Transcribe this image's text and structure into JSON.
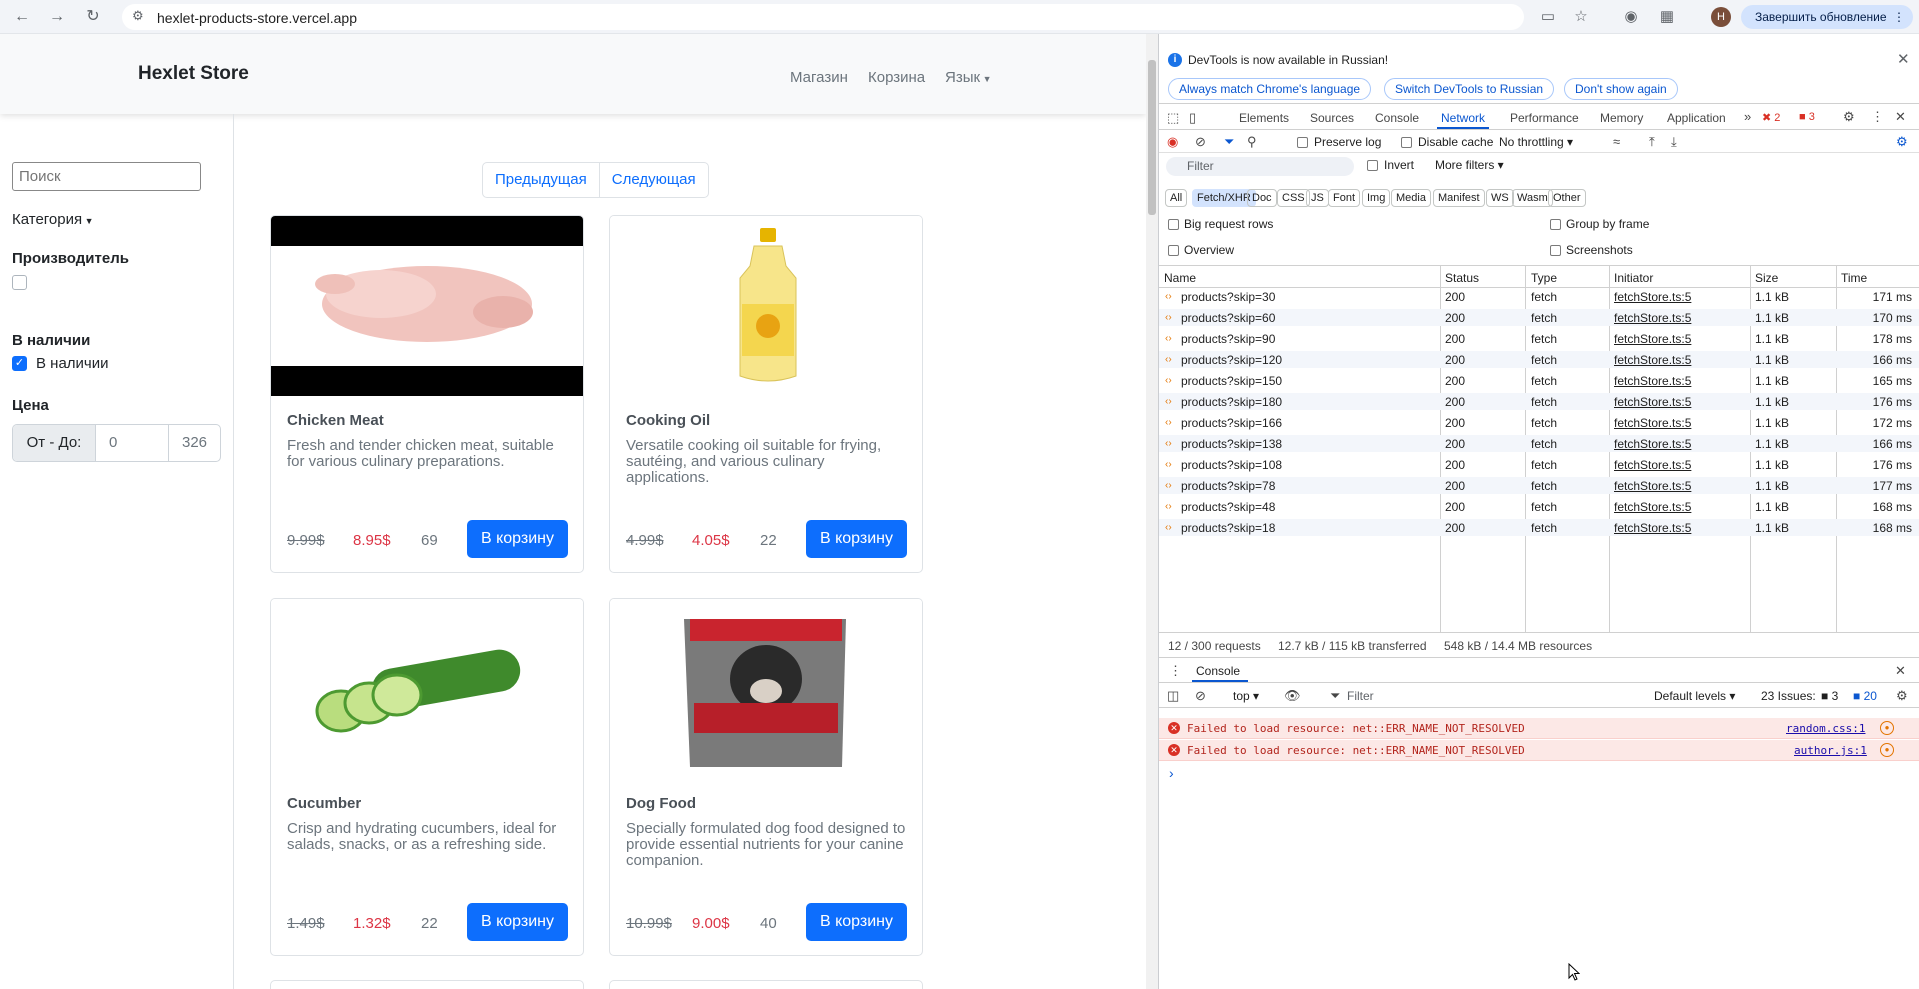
{
  "browser": {
    "url": "hexlet-products-store.vercel.app",
    "avatar_letter": "H",
    "update_label": "Завершить обновление"
  },
  "site": {
    "brand": "Hexlet Store",
    "menu": [
      "Магазин",
      "Корзина",
      "Язык"
    ],
    "search_placeholder": "Поиск",
    "category_label": "Категория",
    "manufacturer_label": "Производитель",
    "stock_heading": "В наличии",
    "stock_checkbox": "В наличии",
    "price_heading": "Цена",
    "price_range_label": "От - До:",
    "price_min": "0",
    "price_max": "326",
    "prev_label": "Предыдущая",
    "next_label": "Следующая",
    "buy_label": "В корзину",
    "products": [
      {
        "title": "Chicken Meat",
        "desc": "Fresh and tender chicken meat, suitable for various culinary preparations.",
        "old": "9.99$",
        "new": "8.95$",
        "qty": "69"
      },
      {
        "title": "Cooking Oil",
        "desc": "Versatile cooking oil suitable for frying, sautéing, and various culinary applications.",
        "old": "4.99$",
        "new": "4.05$",
        "qty": "22"
      },
      {
        "title": "Cucumber",
        "desc": "Crisp and hydrating cucumbers, ideal for salads, snacks, or as a refreshing side.",
        "old": "1.49$",
        "new": "1.32$",
        "qty": "22"
      },
      {
        "title": "Dog Food",
        "desc": "Specially formulated dog food designed to provide essential nutrients for your canine companion.",
        "old": "10.99$",
        "new": "9.00$",
        "qty": "40"
      }
    ]
  },
  "devtools": {
    "info_msg": "DevTools is now available in Russian!",
    "info_buttons": [
      "Always match Chrome's language",
      "Switch DevTools to Russian",
      "Don't show again"
    ],
    "tabs": [
      "Elements",
      "Sources",
      "Console",
      "Network",
      "Performance",
      "Memory",
      "Application"
    ],
    "active_tab": "Network",
    "error_count": "2",
    "warn_count": "3",
    "preserve_log": "Preserve log",
    "disable_cache": "Disable cache",
    "throttling": "No throttling",
    "filter_placeholder": "Filter",
    "invert": "Invert",
    "more_filters": "More filters",
    "type_filters": [
      "All",
      "Fetch/XHR",
      "Doc",
      "CSS",
      "JS",
      "Font",
      "Img",
      "Media",
      "Manifest",
      "WS",
      "Wasm",
      "Other"
    ],
    "selected_type": "Fetch/XHR",
    "options": [
      "Big request rows",
      "Group by frame",
      "Overview",
      "Screenshots"
    ],
    "columns": [
      "Name",
      "Status",
      "Type",
      "Initiator",
      "Size",
      "Time"
    ],
    "requests": [
      {
        "name": "products?skip=30",
        "status": "200",
        "type": "fetch",
        "initiator": "fetchStore.ts:5",
        "size": "1.1 kB",
        "time": "171 ms"
      },
      {
        "name": "products?skip=60",
        "status": "200",
        "type": "fetch",
        "initiator": "fetchStore.ts:5",
        "size": "1.1 kB",
        "time": "170 ms"
      },
      {
        "name": "products?skip=90",
        "status": "200",
        "type": "fetch",
        "initiator": "fetchStore.ts:5",
        "size": "1.1 kB",
        "time": "178 ms"
      },
      {
        "name": "products?skip=120",
        "status": "200",
        "type": "fetch",
        "initiator": "fetchStore.ts:5",
        "size": "1.1 kB",
        "time": "166 ms"
      },
      {
        "name": "products?skip=150",
        "status": "200",
        "type": "fetch",
        "initiator": "fetchStore.ts:5",
        "size": "1.1 kB",
        "time": "165 ms"
      },
      {
        "name": "products?skip=180",
        "status": "200",
        "type": "fetch",
        "initiator": "fetchStore.ts:5",
        "size": "1.1 kB",
        "time": "176 ms"
      },
      {
        "name": "products?skip=166",
        "status": "200",
        "type": "fetch",
        "initiator": "fetchStore.ts:5",
        "size": "1.1 kB",
        "time": "172 ms"
      },
      {
        "name": "products?skip=138",
        "status": "200",
        "type": "fetch",
        "initiator": "fetchStore.ts:5",
        "size": "1.1 kB",
        "time": "166 ms"
      },
      {
        "name": "products?skip=108",
        "status": "200",
        "type": "fetch",
        "initiator": "fetchStore.ts:5",
        "size": "1.1 kB",
        "time": "176 ms"
      },
      {
        "name": "products?skip=78",
        "status": "200",
        "type": "fetch",
        "initiator": "fetchStore.ts:5",
        "size": "1.1 kB",
        "time": "177 ms"
      },
      {
        "name": "products?skip=48",
        "status": "200",
        "type": "fetch",
        "initiator": "fetchStore.ts:5",
        "size": "1.1 kB",
        "time": "168 ms"
      },
      {
        "name": "products?skip=18",
        "status": "200",
        "type": "fetch",
        "initiator": "fetchStore.ts:5",
        "size": "1.1 kB",
        "time": "168 ms"
      }
    ],
    "summary": [
      "12 / 300 requests",
      "12.7 kB / 115 kB transferred",
      "548 kB / 14.4 MB resources"
    ],
    "console_tab": "Console",
    "context": "top",
    "console_filter": "Filter",
    "levels": "Default levels",
    "issues_label": "23 Issues:",
    "issues_err": "3",
    "issues_info": "20",
    "errors": [
      {
        "msg": "Failed to load resource: net::ERR_NAME_NOT_RESOLVED",
        "src": "random.css:1"
      },
      {
        "msg": "Failed to load resource: net::ERR_NAME_NOT_RESOLVED",
        "src": "author.js:1"
      }
    ],
    "prompt": "›"
  }
}
